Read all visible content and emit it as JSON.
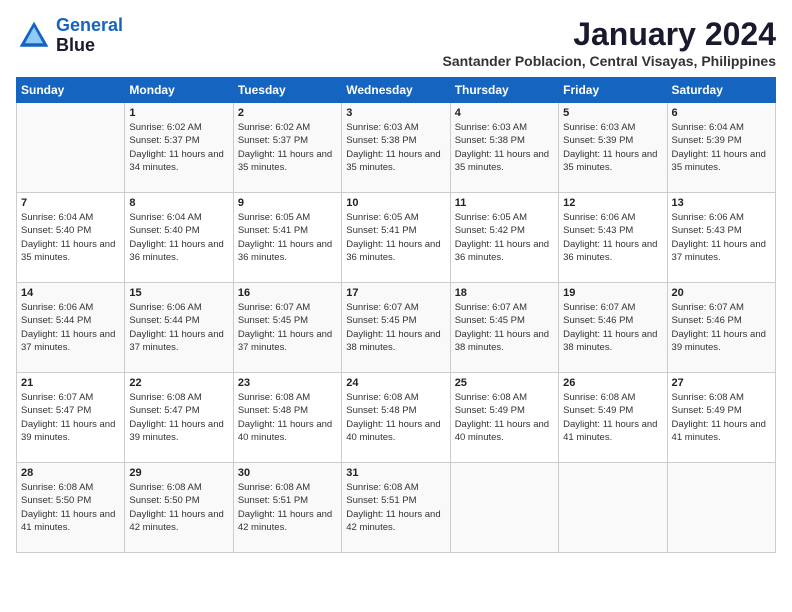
{
  "header": {
    "logo_line1": "General",
    "logo_line2": "Blue",
    "month": "January 2024",
    "location": "Santander Poblacion, Central Visayas, Philippines"
  },
  "weekdays": [
    "Sunday",
    "Monday",
    "Tuesday",
    "Wednesday",
    "Thursday",
    "Friday",
    "Saturday"
  ],
  "weeks": [
    [
      {
        "day": "",
        "sunrise": "",
        "sunset": "",
        "daylight": ""
      },
      {
        "day": "1",
        "sunrise": "Sunrise: 6:02 AM",
        "sunset": "Sunset: 5:37 PM",
        "daylight": "Daylight: 11 hours and 34 minutes."
      },
      {
        "day": "2",
        "sunrise": "Sunrise: 6:02 AM",
        "sunset": "Sunset: 5:37 PM",
        "daylight": "Daylight: 11 hours and 35 minutes."
      },
      {
        "day": "3",
        "sunrise": "Sunrise: 6:03 AM",
        "sunset": "Sunset: 5:38 PM",
        "daylight": "Daylight: 11 hours and 35 minutes."
      },
      {
        "day": "4",
        "sunrise": "Sunrise: 6:03 AM",
        "sunset": "Sunset: 5:38 PM",
        "daylight": "Daylight: 11 hours and 35 minutes."
      },
      {
        "day": "5",
        "sunrise": "Sunrise: 6:03 AM",
        "sunset": "Sunset: 5:39 PM",
        "daylight": "Daylight: 11 hours and 35 minutes."
      },
      {
        "day": "6",
        "sunrise": "Sunrise: 6:04 AM",
        "sunset": "Sunset: 5:39 PM",
        "daylight": "Daylight: 11 hours and 35 minutes."
      }
    ],
    [
      {
        "day": "7",
        "sunrise": "Sunrise: 6:04 AM",
        "sunset": "Sunset: 5:40 PM",
        "daylight": "Daylight: 11 hours and 35 minutes."
      },
      {
        "day": "8",
        "sunrise": "Sunrise: 6:04 AM",
        "sunset": "Sunset: 5:40 PM",
        "daylight": "Daylight: 11 hours and 36 minutes."
      },
      {
        "day": "9",
        "sunrise": "Sunrise: 6:05 AM",
        "sunset": "Sunset: 5:41 PM",
        "daylight": "Daylight: 11 hours and 36 minutes."
      },
      {
        "day": "10",
        "sunrise": "Sunrise: 6:05 AM",
        "sunset": "Sunset: 5:41 PM",
        "daylight": "Daylight: 11 hours and 36 minutes."
      },
      {
        "day": "11",
        "sunrise": "Sunrise: 6:05 AM",
        "sunset": "Sunset: 5:42 PM",
        "daylight": "Daylight: 11 hours and 36 minutes."
      },
      {
        "day": "12",
        "sunrise": "Sunrise: 6:06 AM",
        "sunset": "Sunset: 5:43 PM",
        "daylight": "Daylight: 11 hours and 36 minutes."
      },
      {
        "day": "13",
        "sunrise": "Sunrise: 6:06 AM",
        "sunset": "Sunset: 5:43 PM",
        "daylight": "Daylight: 11 hours and 37 minutes."
      }
    ],
    [
      {
        "day": "14",
        "sunrise": "Sunrise: 6:06 AM",
        "sunset": "Sunset: 5:44 PM",
        "daylight": "Daylight: 11 hours and 37 minutes."
      },
      {
        "day": "15",
        "sunrise": "Sunrise: 6:06 AM",
        "sunset": "Sunset: 5:44 PM",
        "daylight": "Daylight: 11 hours and 37 minutes."
      },
      {
        "day": "16",
        "sunrise": "Sunrise: 6:07 AM",
        "sunset": "Sunset: 5:45 PM",
        "daylight": "Daylight: 11 hours and 37 minutes."
      },
      {
        "day": "17",
        "sunrise": "Sunrise: 6:07 AM",
        "sunset": "Sunset: 5:45 PM",
        "daylight": "Daylight: 11 hours and 38 minutes."
      },
      {
        "day": "18",
        "sunrise": "Sunrise: 6:07 AM",
        "sunset": "Sunset: 5:45 PM",
        "daylight": "Daylight: 11 hours and 38 minutes."
      },
      {
        "day": "19",
        "sunrise": "Sunrise: 6:07 AM",
        "sunset": "Sunset: 5:46 PM",
        "daylight": "Daylight: 11 hours and 38 minutes."
      },
      {
        "day": "20",
        "sunrise": "Sunrise: 6:07 AM",
        "sunset": "Sunset: 5:46 PM",
        "daylight": "Daylight: 11 hours and 39 minutes."
      }
    ],
    [
      {
        "day": "21",
        "sunrise": "Sunrise: 6:07 AM",
        "sunset": "Sunset: 5:47 PM",
        "daylight": "Daylight: 11 hours and 39 minutes."
      },
      {
        "day": "22",
        "sunrise": "Sunrise: 6:08 AM",
        "sunset": "Sunset: 5:47 PM",
        "daylight": "Daylight: 11 hours and 39 minutes."
      },
      {
        "day": "23",
        "sunrise": "Sunrise: 6:08 AM",
        "sunset": "Sunset: 5:48 PM",
        "daylight": "Daylight: 11 hours and 40 minutes."
      },
      {
        "day": "24",
        "sunrise": "Sunrise: 6:08 AM",
        "sunset": "Sunset: 5:48 PM",
        "daylight": "Daylight: 11 hours and 40 minutes."
      },
      {
        "day": "25",
        "sunrise": "Sunrise: 6:08 AM",
        "sunset": "Sunset: 5:49 PM",
        "daylight": "Daylight: 11 hours and 40 minutes."
      },
      {
        "day": "26",
        "sunrise": "Sunrise: 6:08 AM",
        "sunset": "Sunset: 5:49 PM",
        "daylight": "Daylight: 11 hours and 41 minutes."
      },
      {
        "day": "27",
        "sunrise": "Sunrise: 6:08 AM",
        "sunset": "Sunset: 5:49 PM",
        "daylight": "Daylight: 11 hours and 41 minutes."
      }
    ],
    [
      {
        "day": "28",
        "sunrise": "Sunrise: 6:08 AM",
        "sunset": "Sunset: 5:50 PM",
        "daylight": "Daylight: 11 hours and 41 minutes."
      },
      {
        "day": "29",
        "sunrise": "Sunrise: 6:08 AM",
        "sunset": "Sunset: 5:50 PM",
        "daylight": "Daylight: 11 hours and 42 minutes."
      },
      {
        "day": "30",
        "sunrise": "Sunrise: 6:08 AM",
        "sunset": "Sunset: 5:51 PM",
        "daylight": "Daylight: 11 hours and 42 minutes."
      },
      {
        "day": "31",
        "sunrise": "Sunrise: 6:08 AM",
        "sunset": "Sunset: 5:51 PM",
        "daylight": "Daylight: 11 hours and 42 minutes."
      },
      {
        "day": "",
        "sunrise": "",
        "sunset": "",
        "daylight": ""
      },
      {
        "day": "",
        "sunrise": "",
        "sunset": "",
        "daylight": ""
      },
      {
        "day": "",
        "sunrise": "",
        "sunset": "",
        "daylight": ""
      }
    ]
  ]
}
